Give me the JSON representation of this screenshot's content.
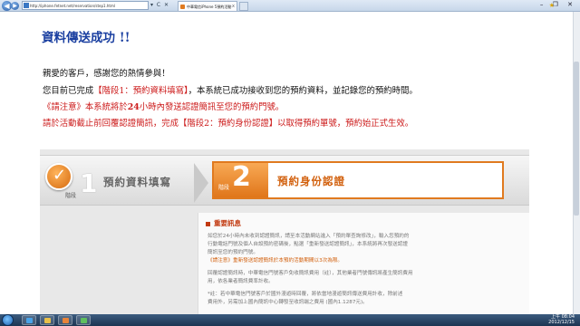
{
  "browser": {
    "address": "http://iphone.fetnet.net/reservation/step1.html",
    "tab_title": "中華電信iPhone 5預約活動",
    "back_label": "◀",
    "forward_label": "▶",
    "tools_label": "▾ C ✕",
    "window_controls": "– ❐ ✕",
    "tab_close": "x",
    "star_icon": "★"
  },
  "page": {
    "title": "資料傳送成功 !!",
    "m1": "親愛的客戶，感謝您的熱情參與！",
    "m2_a": "您目前已完成",
    "m2_b": "【階段1：預約資料填寫】",
    "m2_c": "，本系統已成功接收到您的預約資料，並記錄您的預約時間。",
    "m3_a": "《請注意》本系統將於",
    "m3_b": "24",
    "m3_c": "小時內發送認證簡訊至您的預約門號。",
    "m4_a": "請於活動截止前回覆認證簡訊，完成",
    "m4_b": "【階段2：預約身份認證】",
    "m4_c": "以取得預約單號，預約始正式生效。"
  },
  "steps": {
    "check_mark": "✓",
    "step1_label": "階段",
    "step1_num": "1",
    "step1_text": "預約資料填寫",
    "step2_label": "階段",
    "step2_num": "2",
    "step2_text": "預約身份認證"
  },
  "notice": {
    "title": "重要訊息",
    "l1": "如您於24小時內未收到認證簡訊，請至本活動網站進入「預約單查詢修改」，輸入您預約的",
    "l2": "行動電話門號及個人自設預約密碼後，點選「重新發送認證簡訊」，本系統將再次發送認證",
    "l3": "簡訊至您的預約門號。",
    "l4": "《請注意》重新發送認證簡訊於本預約活動期間以3次為限。",
    "l5": "回覆認證簡訊時，中華電信門號客戶免收簡訊費用（註），其他業者門號傳訊將產生簡訊費用",
    "l6": "用，依各業者簡訊費率計收。",
    "l7": "*註：若中華電信門號客戶於國外漫遊時回覆，將依當地漫遊簡訊傳送費用計收，除前述",
    "l8": "費用外，另需加上國內簡訊中心轉發至收訊端之費用 (國內1.1287元)。"
  },
  "taskbar": {
    "time": "上午 08:04",
    "date": "2012/12/15"
  },
  "colors": {
    "title_blue": "#1a3fa0",
    "alert_red": "#cc1a1a",
    "step_orange": "#e07a1f"
  }
}
